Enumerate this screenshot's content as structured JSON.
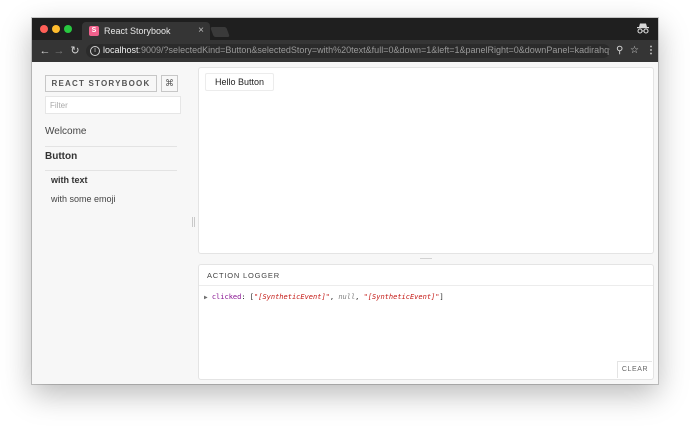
{
  "browser": {
    "tab": {
      "favicon_letter": "S",
      "title": "React Storybook",
      "close": "×"
    },
    "address": {
      "host": "localhost",
      "rest": ":9009/?selectedKind=Button&selectedStory=with%20text&full=0&down=1&left=1&panelRight=0&downPanel=kadirahq%2Fst..."
    },
    "icons": {
      "back": "←",
      "forward": "→",
      "reload": "↻",
      "info": "i",
      "zoom": "⚲",
      "star": "☆",
      "menu": "⋮"
    }
  },
  "sidebar": {
    "title": "REACT STORYBOOK",
    "shortcut_label": "⌘",
    "filter_placeholder": "Filter",
    "kinds": [
      {
        "name": "Welcome"
      },
      {
        "name": "Button",
        "stories": [
          "with text",
          "with some emoji"
        ],
        "selected_story": "with text"
      }
    ]
  },
  "preview": {
    "button_label": "Hello Button"
  },
  "panel": {
    "tab_label": "ACTION LOGGER",
    "log": {
      "arrow": "▶",
      "key": "clicked",
      "sep": ": ",
      "open": "[",
      "items": [
        "\"[SyntheticEvent]\"",
        "null",
        "\"[SyntheticEvent]\""
      ],
      "comma": ", ",
      "close": "]"
    },
    "clear_label": "CLEAR"
  },
  "colors": {
    "storybook_pink": "#f1618c",
    "json_key": "#881391",
    "json_string": "#c41a16",
    "json_null": "#808080"
  }
}
